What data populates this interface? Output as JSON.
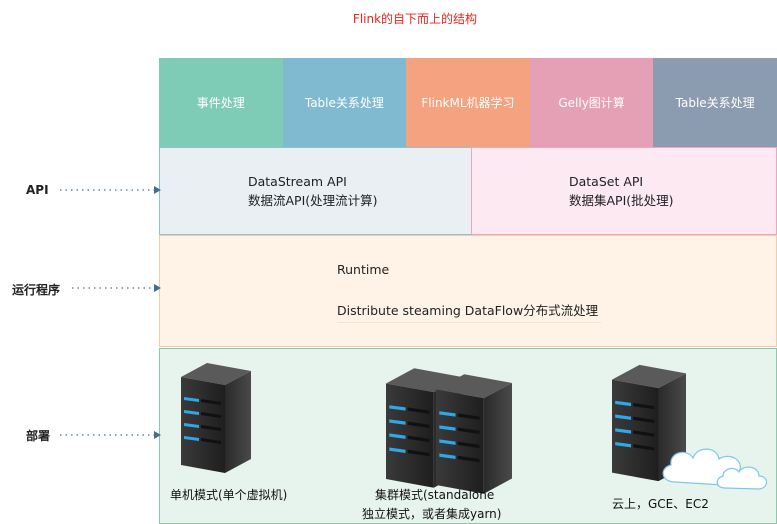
{
  "title": "Flink的自下而上的结构",
  "libraries": [
    {
      "label": "事件处理",
      "color": "#7ecbb6"
    },
    {
      "label": "Table关系处理",
      "color": "#7fbad0"
    },
    {
      "label": "FlinkML机器学习",
      "color": "#f4a27f"
    },
    {
      "label": "Gelly图计算",
      "color": "#e6a0b5"
    },
    {
      "label": "Table关系处理",
      "color": "#8c9cb0"
    }
  ],
  "api": {
    "datastream": {
      "line1": "DataStream API",
      "line2": "数据流API(处理流计算)"
    },
    "dataset": {
      "line1": "DataSet API",
      "line2": "数据集API(批处理)"
    }
  },
  "runtime": {
    "label": "Runtime",
    "description": "Distribute steaming DataFlow分布式流处理"
  },
  "deploy": {
    "single": "单机模式(单个虚拟机)",
    "cluster_line1": "集群模式(standalone",
    "cluster_line2": "独立模式，或者集成yarn)",
    "cloud": "云上，GCE、EC2"
  },
  "side_labels": {
    "api": "API",
    "runtime": "运行程序",
    "deploy": "部署"
  }
}
